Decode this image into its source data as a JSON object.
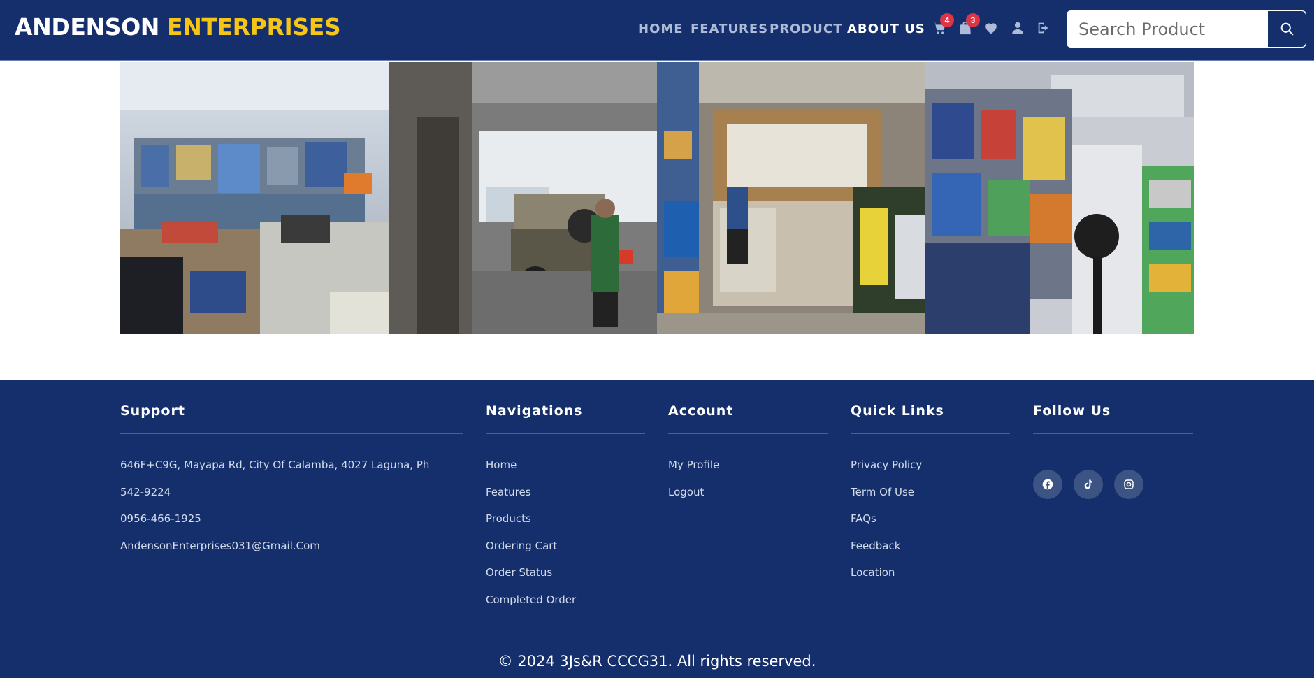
{
  "brand": {
    "name_part1": "ANDENSON",
    "name_part2": "ENTERPRISES"
  },
  "nav": {
    "links": [
      {
        "label": "HOME",
        "active": false
      },
      {
        "label": "FEATURES",
        "active": false
      },
      {
        "label": "PRODUCT",
        "active": false
      },
      {
        "label": "ABOUT US",
        "active": true
      }
    ],
    "icons": [
      {
        "name": "cart-icon",
        "badge": "4"
      },
      {
        "name": "shopping-bag-icon",
        "badge": "3"
      },
      {
        "name": "heart-icon",
        "badge": ""
      },
      {
        "name": "user-icon",
        "badge": ""
      },
      {
        "name": "logout-icon",
        "badge": ""
      }
    ]
  },
  "search": {
    "placeholder": "Search Product",
    "value": "",
    "button_icon": "search-icon"
  },
  "gallery": {
    "photos": [
      {
        "name": "store-interior-photo"
      },
      {
        "name": "store-entrance-photo"
      },
      {
        "name": "hardware-counter-photo"
      },
      {
        "name": "hardware-shelves-photo"
      }
    ]
  },
  "footer": {
    "support": {
      "title": "Support",
      "items": [
        "646F+C9G, Mayapa Rd, City Of Calamba, 4027 Laguna, Ph",
        "542-9224",
        "0956-466-1925",
        "AndensonEnterprises031@Gmail.Com"
      ]
    },
    "navigations": {
      "title": "Navigations",
      "items": [
        "Home",
        "Features",
        "Products",
        "Ordering Cart",
        "Order Status",
        "Completed Order"
      ]
    },
    "account": {
      "title": "Account",
      "items": [
        "My Profile",
        "Logout"
      ]
    },
    "quick_links": {
      "title": "Quick Links",
      "items": [
        "Privacy Policy",
        "Term Of Use",
        "FAQs",
        "Feedback",
        "Location"
      ]
    },
    "follow_us": {
      "title": "Follow Us",
      "icons": [
        "facebook-icon",
        "tiktok-icon",
        "instagram-icon"
      ]
    },
    "copyright": "© 2024 3Js&R CCCG31. All rights reserved."
  },
  "colors": {
    "primary": "#142f6b",
    "accent": "#f5c518",
    "badge": "#dc3545",
    "social_bg": "#3c5484"
  }
}
